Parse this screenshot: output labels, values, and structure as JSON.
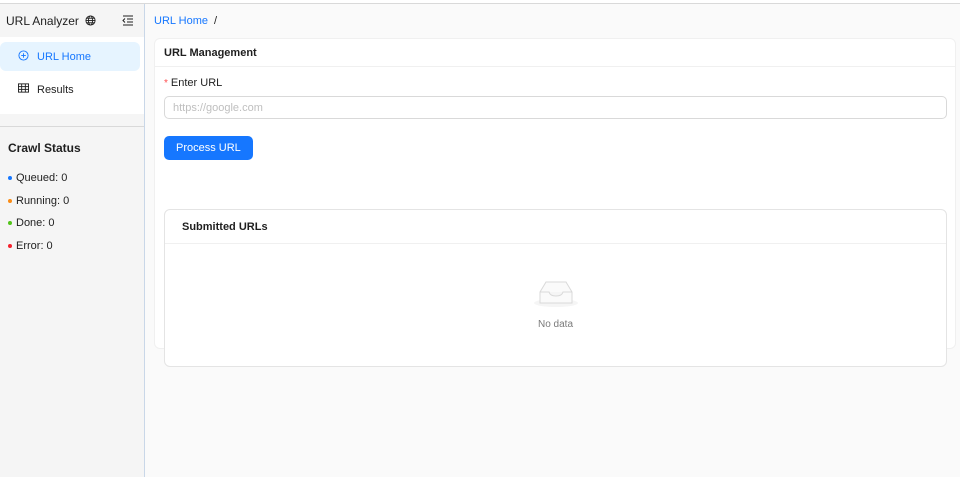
{
  "app": {
    "title": "URL Analyzer"
  },
  "sidebar": {
    "items": [
      {
        "label": "URL Home",
        "icon": "plus-circle-icon",
        "active": true
      },
      {
        "label": "Results",
        "icon": "table-icon",
        "active": false
      }
    ]
  },
  "crawl_status": {
    "title": "Crawl Status",
    "rows": [
      {
        "label": "Queued: 0",
        "color": "#1677ff"
      },
      {
        "label": "Running: 0",
        "color": "#fa8c16"
      },
      {
        "label": "Done: 0",
        "color": "#52c41a"
      },
      {
        "label": "Error: 0",
        "color": "#f5222d"
      }
    ]
  },
  "breadcrumb": {
    "current": "URL Home",
    "separator": "/"
  },
  "url_management": {
    "title": "URL Management",
    "required_mark": "*",
    "field_label": "Enter URL",
    "placeholder": "https://google.com",
    "value": "",
    "button_label": "Process URL"
  },
  "submitted": {
    "title": "Submitted URLs",
    "empty_text": "No data"
  },
  "colors": {
    "accent": "#1677ff",
    "active_bg": "#e6f4ff"
  }
}
